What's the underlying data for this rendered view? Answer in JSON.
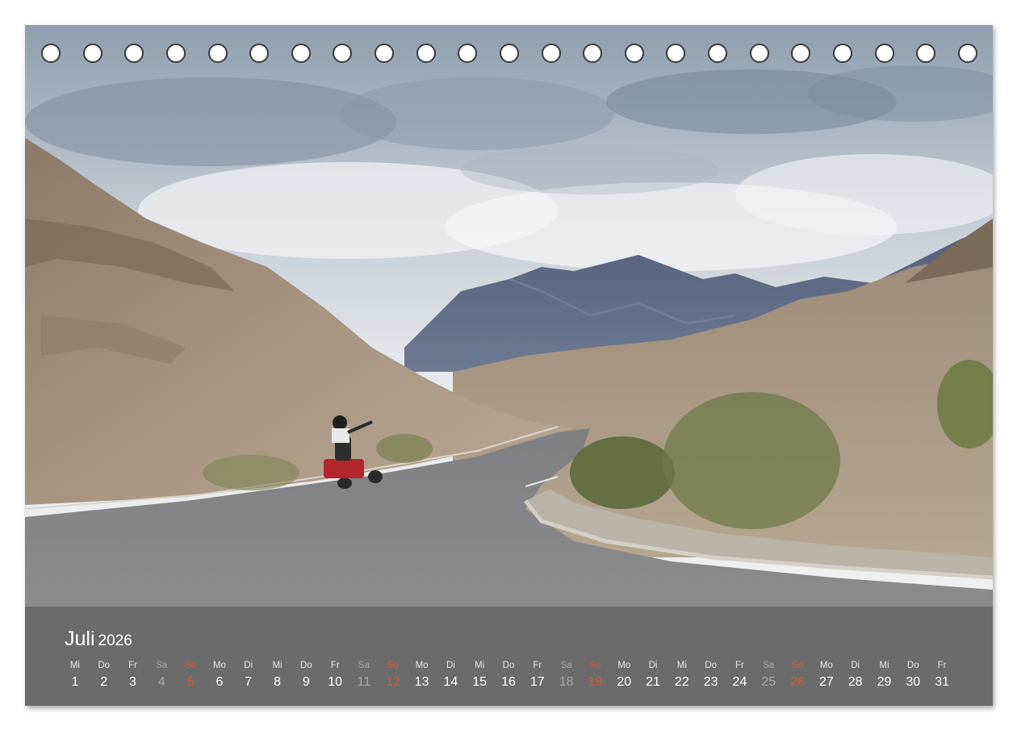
{
  "calendar": {
    "month": "Juli",
    "year": "2026",
    "colors": {
      "band": "#6b6b6b",
      "text": "#ffffff",
      "saturday": "#a8a8a8",
      "sunday": "#e0552e"
    },
    "days": [
      {
        "wd": "Mi",
        "d": "1",
        "type": "weekday"
      },
      {
        "wd": "Do",
        "d": "2",
        "type": "weekday"
      },
      {
        "wd": "Fr",
        "d": "3",
        "type": "weekday"
      },
      {
        "wd": "Sa",
        "d": "4",
        "type": "sat"
      },
      {
        "wd": "So",
        "d": "5",
        "type": "sun"
      },
      {
        "wd": "Mo",
        "d": "6",
        "type": "weekday"
      },
      {
        "wd": "Di",
        "d": "7",
        "type": "weekday"
      },
      {
        "wd": "Mi",
        "d": "8",
        "type": "weekday"
      },
      {
        "wd": "Do",
        "d": "9",
        "type": "weekday"
      },
      {
        "wd": "Fr",
        "d": "10",
        "type": "weekday"
      },
      {
        "wd": "Sa",
        "d": "11",
        "type": "sat"
      },
      {
        "wd": "So",
        "d": "12",
        "type": "sun"
      },
      {
        "wd": "Mo",
        "d": "13",
        "type": "weekday"
      },
      {
        "wd": "Di",
        "d": "14",
        "type": "weekday"
      },
      {
        "wd": "Mi",
        "d": "15",
        "type": "weekday"
      },
      {
        "wd": "Do",
        "d": "16",
        "type": "weekday"
      },
      {
        "wd": "Fr",
        "d": "17",
        "type": "weekday"
      },
      {
        "wd": "Sa",
        "d": "18",
        "type": "sat"
      },
      {
        "wd": "So",
        "d": "19",
        "type": "sun"
      },
      {
        "wd": "Mo",
        "d": "20",
        "type": "weekday"
      },
      {
        "wd": "Di",
        "d": "21",
        "type": "weekday"
      },
      {
        "wd": "Mi",
        "d": "22",
        "type": "weekday"
      },
      {
        "wd": "Do",
        "d": "23",
        "type": "weekday"
      },
      {
        "wd": "Fr",
        "d": "24",
        "type": "weekday"
      },
      {
        "wd": "Sa",
        "d": "25",
        "type": "sat"
      },
      {
        "wd": "So",
        "d": "26",
        "type": "sun"
      },
      {
        "wd": "Mo",
        "d": "27",
        "type": "weekday"
      },
      {
        "wd": "Di",
        "d": "28",
        "type": "weekday"
      },
      {
        "wd": "Mi",
        "d": "29",
        "type": "weekday"
      },
      {
        "wd": "Do",
        "d": "30",
        "type": "weekday"
      },
      {
        "wd": "Fr",
        "d": "31",
        "type": "weekday"
      }
    ]
  },
  "binding": {
    "hole_count": 23
  }
}
